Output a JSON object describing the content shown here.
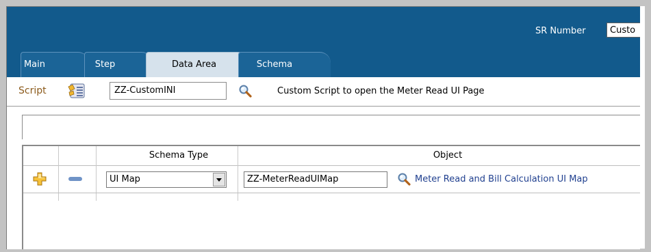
{
  "header": {
    "sr_number_label": "SR Number",
    "sr_number_value": "Custo"
  },
  "tabs": [
    {
      "label": "Main"
    },
    {
      "label": "Step"
    },
    {
      "label": "Data Area",
      "active": true
    },
    {
      "label": "Schema"
    }
  ],
  "script": {
    "label": "Script",
    "value": "ZZ-CustomINI",
    "description": "Custom Script to open the Meter Read UI Page"
  },
  "grid": {
    "headers": {
      "schema_type": "Schema Type",
      "object": "Object"
    },
    "rows": [
      {
        "schema_type": "UI Map",
        "object": "ZZ-MeterReadUIMap",
        "object_description": "Meter Read and Bill Calculation UI Map"
      }
    ]
  },
  "colors": {
    "header_bg": "#125a8c",
    "tab_active_bg": "#d6e2ec",
    "script_label": "#8b5a1b",
    "link_text": "#1f3f8f",
    "add_icon": "#f0b731",
    "remove_icon": "#6f93c7"
  }
}
